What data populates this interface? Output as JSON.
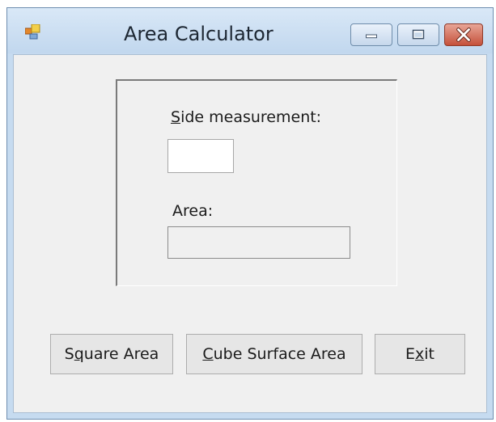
{
  "window": {
    "title": "Area Calculator",
    "icon": "app-form-icon",
    "caption_buttons": [
      "minimize-icon",
      "maximize-icon",
      "close-icon"
    ]
  },
  "form": {
    "side_label": {
      "mnemonic": "S",
      "rest": "ide measurement:"
    },
    "side_value": "",
    "area_label": "Area:",
    "area_value": ""
  },
  "buttons": {
    "square": {
      "before": "S",
      "mnemonic": "q",
      "after": "uare Area"
    },
    "cube": {
      "before": "",
      "mnemonic": "C",
      "after": "ube Surface Area"
    },
    "exit": {
      "before": "E",
      "mnemonic": "x",
      "after": "it"
    }
  },
  "colors": {
    "frame": "#c6dbf0",
    "client": "#f0f0f0",
    "close_button": "#c5513b"
  }
}
